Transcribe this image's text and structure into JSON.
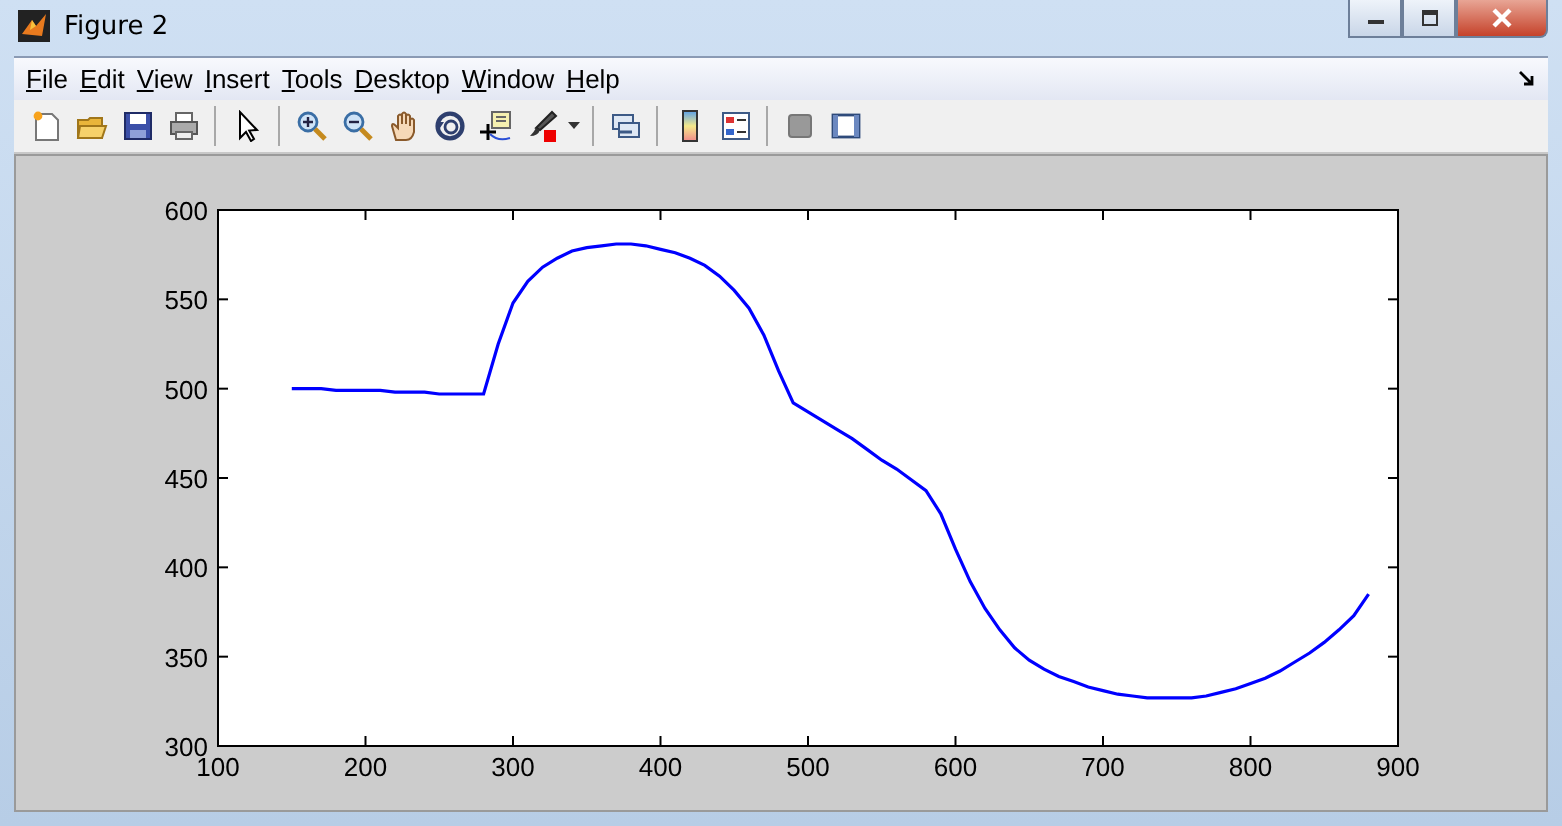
{
  "window": {
    "title": "Figure 2"
  },
  "menu": [
    "File",
    "Edit",
    "View",
    "Insert",
    "Tools",
    "Desktop",
    "Window",
    "Help"
  ],
  "axes": {
    "chart_data": {
      "type": "line",
      "xlim": [
        100,
        900
      ],
      "ylim": [
        300,
        600
      ],
      "xticks": [
        100,
        200,
        300,
        400,
        500,
        600,
        700,
        800,
        900
      ],
      "yticks": [
        300,
        350,
        400,
        450,
        500,
        550,
        600
      ],
      "x": [
        150,
        160,
        170,
        180,
        190,
        200,
        210,
        220,
        230,
        240,
        250,
        260,
        270,
        280,
        290,
        300,
        310,
        320,
        330,
        340,
        350,
        360,
        370,
        380,
        390,
        400,
        410,
        420,
        430,
        440,
        450,
        460,
        470,
        480,
        490,
        500,
        510,
        520,
        530,
        540,
        550,
        560,
        570,
        580,
        590,
        600,
        610,
        620,
        630,
        640,
        650,
        660,
        670,
        680,
        690,
        700,
        710,
        720,
        730,
        740,
        750,
        760,
        770,
        780,
        790,
        800,
        810,
        820,
        830,
        840,
        850,
        860,
        870,
        880
      ],
      "series": [
        {
          "color": "#0000ff",
          "values": [
            500,
            500,
            500,
            499,
            499,
            499,
            499,
            498,
            498,
            498,
            497,
            497,
            497,
            497,
            525,
            548,
            560,
            568,
            573,
            577,
            579,
            580,
            581,
            581,
            580,
            578,
            576,
            573,
            569,
            563,
            555,
            545,
            530,
            510,
            492,
            487,
            482,
            477,
            472,
            466,
            460,
            455,
            449,
            443,
            430,
            410,
            392,
            377,
            365,
            355,
            348,
            343,
            339,
            336,
            333,
            331,
            329,
            328,
            327,
            327,
            327,
            327,
            328,
            330,
            332,
            335,
            338,
            342,
            347,
            352,
            358,
            365,
            373,
            385
          ]
        }
      ]
    }
  }
}
